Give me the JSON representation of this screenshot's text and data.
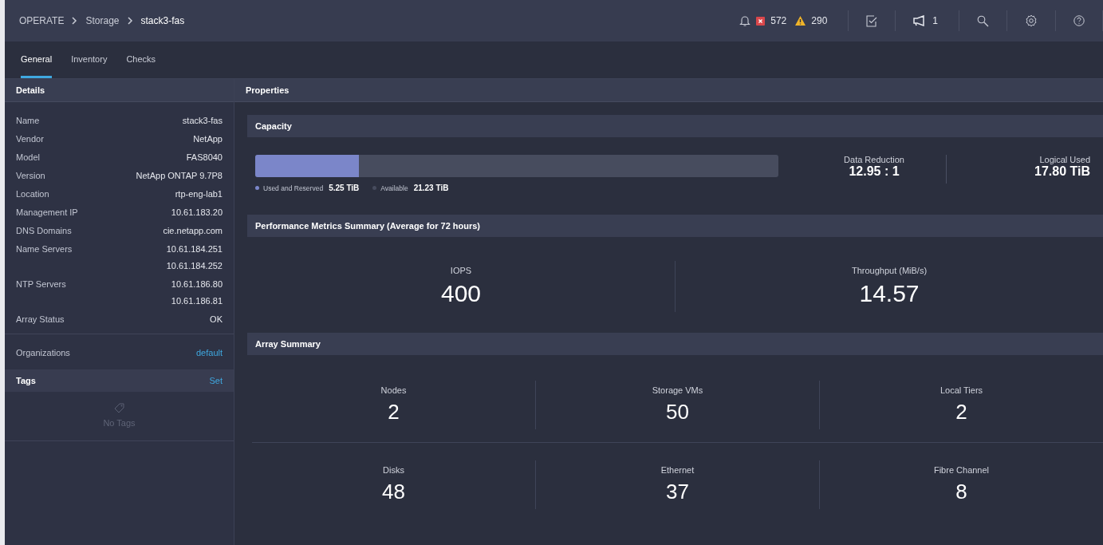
{
  "breadcrumb": [
    "OPERATE",
    "Storage",
    "stack3-fas"
  ],
  "header": {
    "critical_count": "572",
    "warning_count": "290",
    "announcement_count": "1"
  },
  "tabs": [
    {
      "label": "General",
      "selected": true
    },
    {
      "label": "Inventory",
      "selected": false
    },
    {
      "label": "Checks",
      "selected": false
    }
  ],
  "details": {
    "title": "Details",
    "rows": [
      {
        "label": "Name",
        "values": [
          "stack3-fas"
        ]
      },
      {
        "label": "Vendor",
        "values": [
          "NetApp"
        ]
      },
      {
        "label": "Model",
        "values": [
          "FAS8040"
        ]
      },
      {
        "label": "Version",
        "values": [
          "NetApp ONTAP 9.7P8"
        ]
      },
      {
        "label": "Location",
        "values": [
          "rtp-eng-lab1"
        ]
      },
      {
        "label": "Management IP",
        "values": [
          "10.61.183.20"
        ]
      },
      {
        "label": "DNS Domains",
        "values": [
          "cie.netapp.com"
        ]
      },
      {
        "label": "Name Servers",
        "values": [
          "10.61.184.251",
          "10.61.184.252"
        ]
      },
      {
        "label": "NTP Servers",
        "values": [
          "10.61.186.80",
          "10.61.186.81"
        ]
      },
      {
        "label": "Array Status",
        "values": [
          "OK"
        ]
      }
    ],
    "organizations": {
      "label": "Organizations",
      "value": "default"
    },
    "tags": {
      "label": "Tags",
      "action": "Set",
      "empty_text": "No Tags"
    }
  },
  "properties": {
    "title": "Properties",
    "capacity": {
      "title": "Capacity",
      "level": 0.198,
      "used_label": "Used and Reserved",
      "used_value": "5.25 TiB",
      "available_label": "Available",
      "available_value": "21.23 TiB",
      "stats": [
        {
          "label": "Data Reduction",
          "value": "12.95 : 1"
        },
        {
          "label": "Logical Used",
          "value": "17.80 TiB"
        }
      ]
    },
    "performance": {
      "title": "Performance Metrics Summary (Average for 72 hours)",
      "metrics": [
        {
          "label": "IOPS",
          "value": "400"
        },
        {
          "label": "Throughput (MiB/s)",
          "value": "14.57"
        }
      ]
    },
    "array_summary": {
      "title": "Array Summary",
      "rows": [
        [
          {
            "label": "Nodes",
            "value": "2"
          },
          {
            "label": "Storage VMs",
            "value": "50"
          },
          {
            "label": "Local Tiers",
            "value": "2"
          }
        ],
        [
          {
            "label": "Disks",
            "value": "48"
          },
          {
            "label": "Ethernet",
            "value": "37"
          },
          {
            "label": "Fibre Channel",
            "value": "8"
          }
        ]
      ]
    }
  }
}
